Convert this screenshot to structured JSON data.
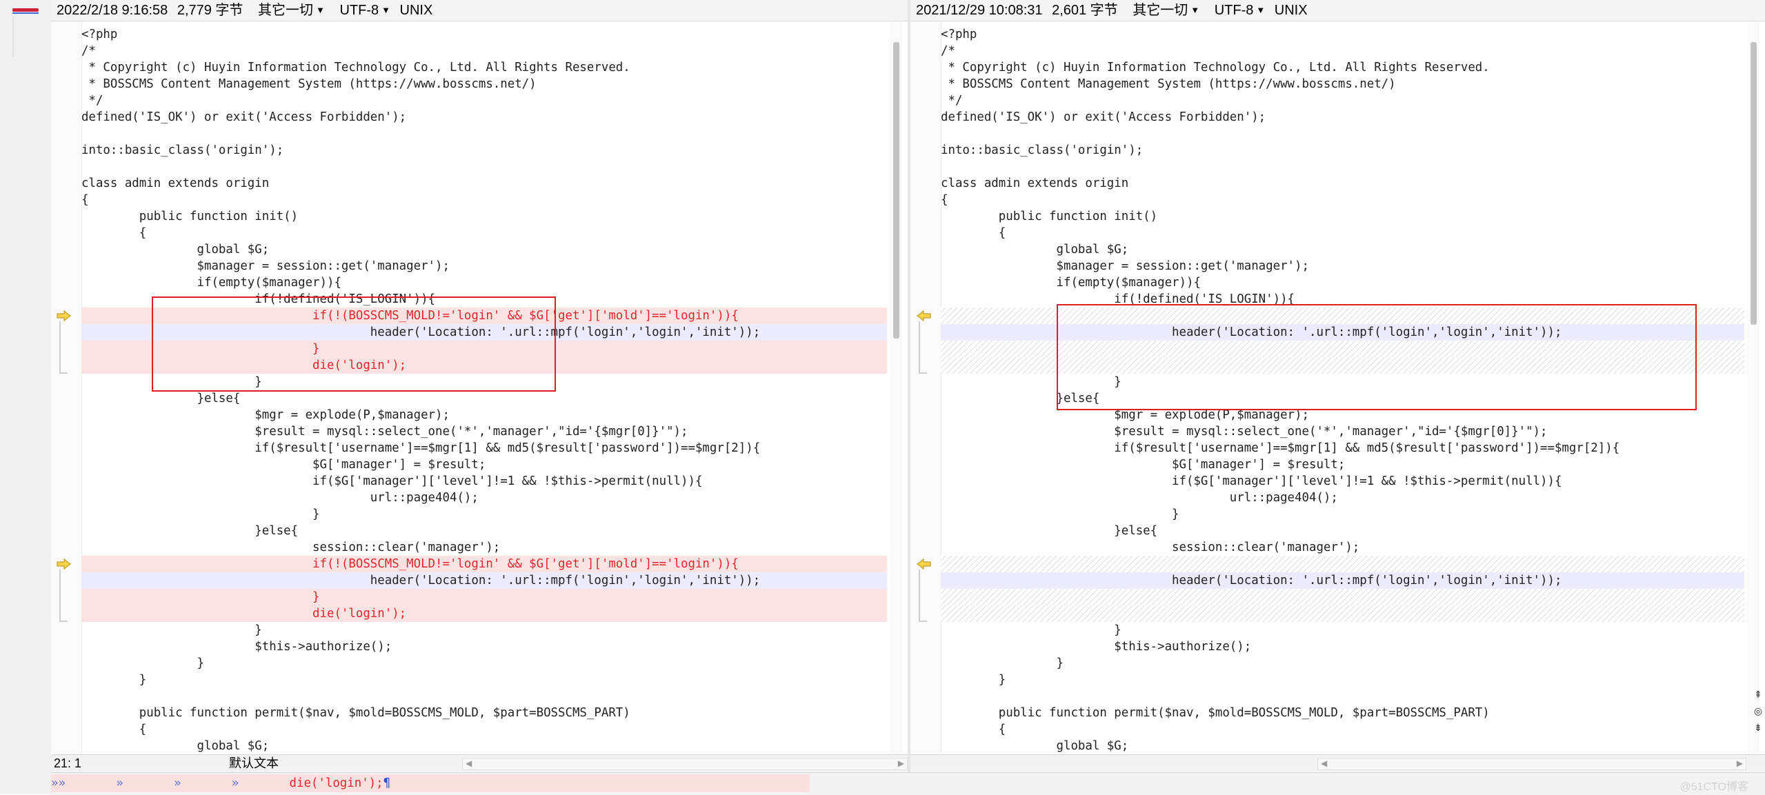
{
  "left": {
    "header": {
      "datetime": "2022/2/18 9:16:58",
      "size": "2,779 字节",
      "misc": "其它一切",
      "encoding": "UTF-8",
      "lineend": "UNIX"
    },
    "lines": [
      {
        "text": "<?php",
        "kind": "normal"
      },
      {
        "text": "/*",
        "kind": "normal"
      },
      {
        "text": " * Copyright (c) Huyin Information Technology Co., Ltd. All Rights Reserved.",
        "kind": "normal"
      },
      {
        "text": " * BOSSCMS Content Management System (https://www.bosscms.net/)",
        "kind": "normal"
      },
      {
        "text": " */",
        "kind": "normal"
      },
      {
        "text": "defined('IS_OK') or exit('Access Forbidden');",
        "kind": "normal"
      },
      {
        "text": "",
        "kind": "normal"
      },
      {
        "text": "into::basic_class('origin');",
        "kind": "normal"
      },
      {
        "text": "",
        "kind": "normal"
      },
      {
        "text": "class admin extends origin",
        "kind": "normal"
      },
      {
        "text": "{",
        "kind": "normal"
      },
      {
        "text": "        public function init()",
        "kind": "normal"
      },
      {
        "text": "        {",
        "kind": "normal"
      },
      {
        "text": "                global $G;",
        "kind": "normal"
      },
      {
        "text": "                $manager = session::get('manager');",
        "kind": "normal"
      },
      {
        "text": "                if(empty($manager)){",
        "kind": "normal"
      },
      {
        "text": "                        if(!defined('IS_LOGIN')){",
        "kind": "normal"
      },
      {
        "text": "                                if(!(BOSSCMS_MOLD!='login' && $G['get']['mold']=='login')){",
        "kind": "del"
      },
      {
        "text": "                                        header('Location: '.url::mpf('login','login','init'));",
        "kind": "mod"
      },
      {
        "text": "                                }",
        "kind": "del"
      },
      {
        "text": "                                die('login');",
        "kind": "del"
      },
      {
        "text": "                        }",
        "kind": "normal"
      },
      {
        "text": "                }else{",
        "kind": "normal"
      },
      {
        "text": "                        $mgr = explode(P,$manager);",
        "kind": "normal"
      },
      {
        "text": "                        $result = mysql::select_one('*','manager',\"id='{$mgr[0]}'\");",
        "kind": "normal"
      },
      {
        "text": "                        if($result['username']==$mgr[1] && md5($result['password'])==$mgr[2]){",
        "kind": "normal"
      },
      {
        "text": "                                $G['manager'] = $result;",
        "kind": "normal"
      },
      {
        "text": "                                if($G['manager']['level']!=1 && !$this->permit(null)){",
        "kind": "normal"
      },
      {
        "text": "                                        url::page404();",
        "kind": "normal"
      },
      {
        "text": "                                }",
        "kind": "normal"
      },
      {
        "text": "                        }else{",
        "kind": "normal"
      },
      {
        "text": "                                session::clear('manager');",
        "kind": "normal"
      },
      {
        "text": "                                if(!(BOSSCMS_MOLD!='login' && $G['get']['mold']=='login')){",
        "kind": "del"
      },
      {
        "text": "                                        header('Location: '.url::mpf('login','login','init'));",
        "kind": "mod"
      },
      {
        "text": "                                }",
        "kind": "del"
      },
      {
        "text": "                                die('login');",
        "kind": "del"
      },
      {
        "text": "                        }",
        "kind": "normal"
      },
      {
        "text": "                        $this->authorize();",
        "kind": "normal"
      },
      {
        "text": "                }",
        "kind": "normal"
      },
      {
        "text": "        }",
        "kind": "normal"
      },
      {
        "text": "",
        "kind": "normal"
      },
      {
        "text": "        public function permit($nav, $mold=BOSSCMS_MOLD, $part=BOSSCMS_PART)",
        "kind": "normal"
      },
      {
        "text": "        {",
        "kind": "normal"
      },
      {
        "text": "                global $G;",
        "kind": "normal"
      }
    ],
    "status": {
      "position": "21: 1",
      "syntax": "默认文本"
    }
  },
  "right": {
    "header": {
      "datetime": "2021/12/29 10:08:31",
      "size": "2,601 字节",
      "misc": "其它一切",
      "encoding": "UTF-8",
      "lineend": "UNIX"
    },
    "lines": [
      {
        "text": "<?php",
        "kind": "normal"
      },
      {
        "text": "/*",
        "kind": "normal"
      },
      {
        "text": " * Copyright (c) Huyin Information Technology Co., Ltd. All Rights Reserved.",
        "kind": "normal"
      },
      {
        "text": " * BOSSCMS Content Management System (https://www.bosscms.net/)",
        "kind": "normal"
      },
      {
        "text": " */",
        "kind": "normal"
      },
      {
        "text": "defined('IS_OK') or exit('Access Forbidden');",
        "kind": "normal"
      },
      {
        "text": "",
        "kind": "normal"
      },
      {
        "text": "into::basic_class('origin');",
        "kind": "normal"
      },
      {
        "text": "",
        "kind": "normal"
      },
      {
        "text": "class admin extends origin",
        "kind": "normal"
      },
      {
        "text": "{",
        "kind": "normal"
      },
      {
        "text": "        public function init()",
        "kind": "normal"
      },
      {
        "text": "        {",
        "kind": "normal"
      },
      {
        "text": "                global $G;",
        "kind": "normal"
      },
      {
        "text": "                $manager = session::get('manager');",
        "kind": "normal"
      },
      {
        "text": "                if(empty($manager)){",
        "kind": "normal"
      },
      {
        "text": "                        if(!defined('IS_LOGIN')){",
        "kind": "normal"
      },
      {
        "text": "",
        "kind": "hatch"
      },
      {
        "text": "                                header('Location: '.url::mpf('login','login','init'));",
        "kind": "mod"
      },
      {
        "text": "",
        "kind": "hatch"
      },
      {
        "text": "",
        "kind": "hatch"
      },
      {
        "text": "                        }",
        "kind": "normal"
      },
      {
        "text": "                }else{",
        "kind": "normal"
      },
      {
        "text": "                        $mgr = explode(P,$manager);",
        "kind": "normal"
      },
      {
        "text": "                        $result = mysql::select_one('*','manager',\"id='{$mgr[0]}'\");",
        "kind": "normal"
      },
      {
        "text": "                        if($result['username']==$mgr[1] && md5($result['password'])==$mgr[2]){",
        "kind": "normal"
      },
      {
        "text": "                                $G['manager'] = $result;",
        "kind": "normal"
      },
      {
        "text": "                                if($G['manager']['level']!=1 && !$this->permit(null)){",
        "kind": "normal"
      },
      {
        "text": "                                        url::page404();",
        "kind": "normal"
      },
      {
        "text": "                                }",
        "kind": "normal"
      },
      {
        "text": "                        }else{",
        "kind": "normal"
      },
      {
        "text": "                                session::clear('manager');",
        "kind": "normal"
      },
      {
        "text": "",
        "kind": "hatch"
      },
      {
        "text": "                                header('Location: '.url::mpf('login','login','init'));",
        "kind": "mod"
      },
      {
        "text": "",
        "kind": "hatch"
      },
      {
        "text": "",
        "kind": "hatch"
      },
      {
        "text": "                        }",
        "kind": "normal"
      },
      {
        "text": "                        $this->authorize();",
        "kind": "normal"
      },
      {
        "text": "                }",
        "kind": "normal"
      },
      {
        "text": "        }",
        "kind": "normal"
      },
      {
        "text": "",
        "kind": "normal"
      },
      {
        "text": "        public function permit($nav, $mold=BOSSCMS_MOLD, $part=BOSSCMS_PART)",
        "kind": "normal"
      },
      {
        "text": "        {",
        "kind": "normal"
      },
      {
        "text": "                global $G;",
        "kind": "normal"
      }
    ]
  },
  "bottom": {
    "tab_glyphs": "»»       »       »       »       ",
    "deleted_text": "die('login');",
    "pilcrow": "¶",
    "watermark": "@51CTO博客"
  },
  "icons": {
    "change_arrow": "diff-arrow-icon",
    "up": "scroll-up-icon",
    "down": "scroll-down-icon"
  },
  "colors": {
    "deleted_bg": "#fbe3e3",
    "deleted_fg": "#e0262a",
    "modified_bg": "#ecebfd",
    "annotation": "#e21a22"
  }
}
